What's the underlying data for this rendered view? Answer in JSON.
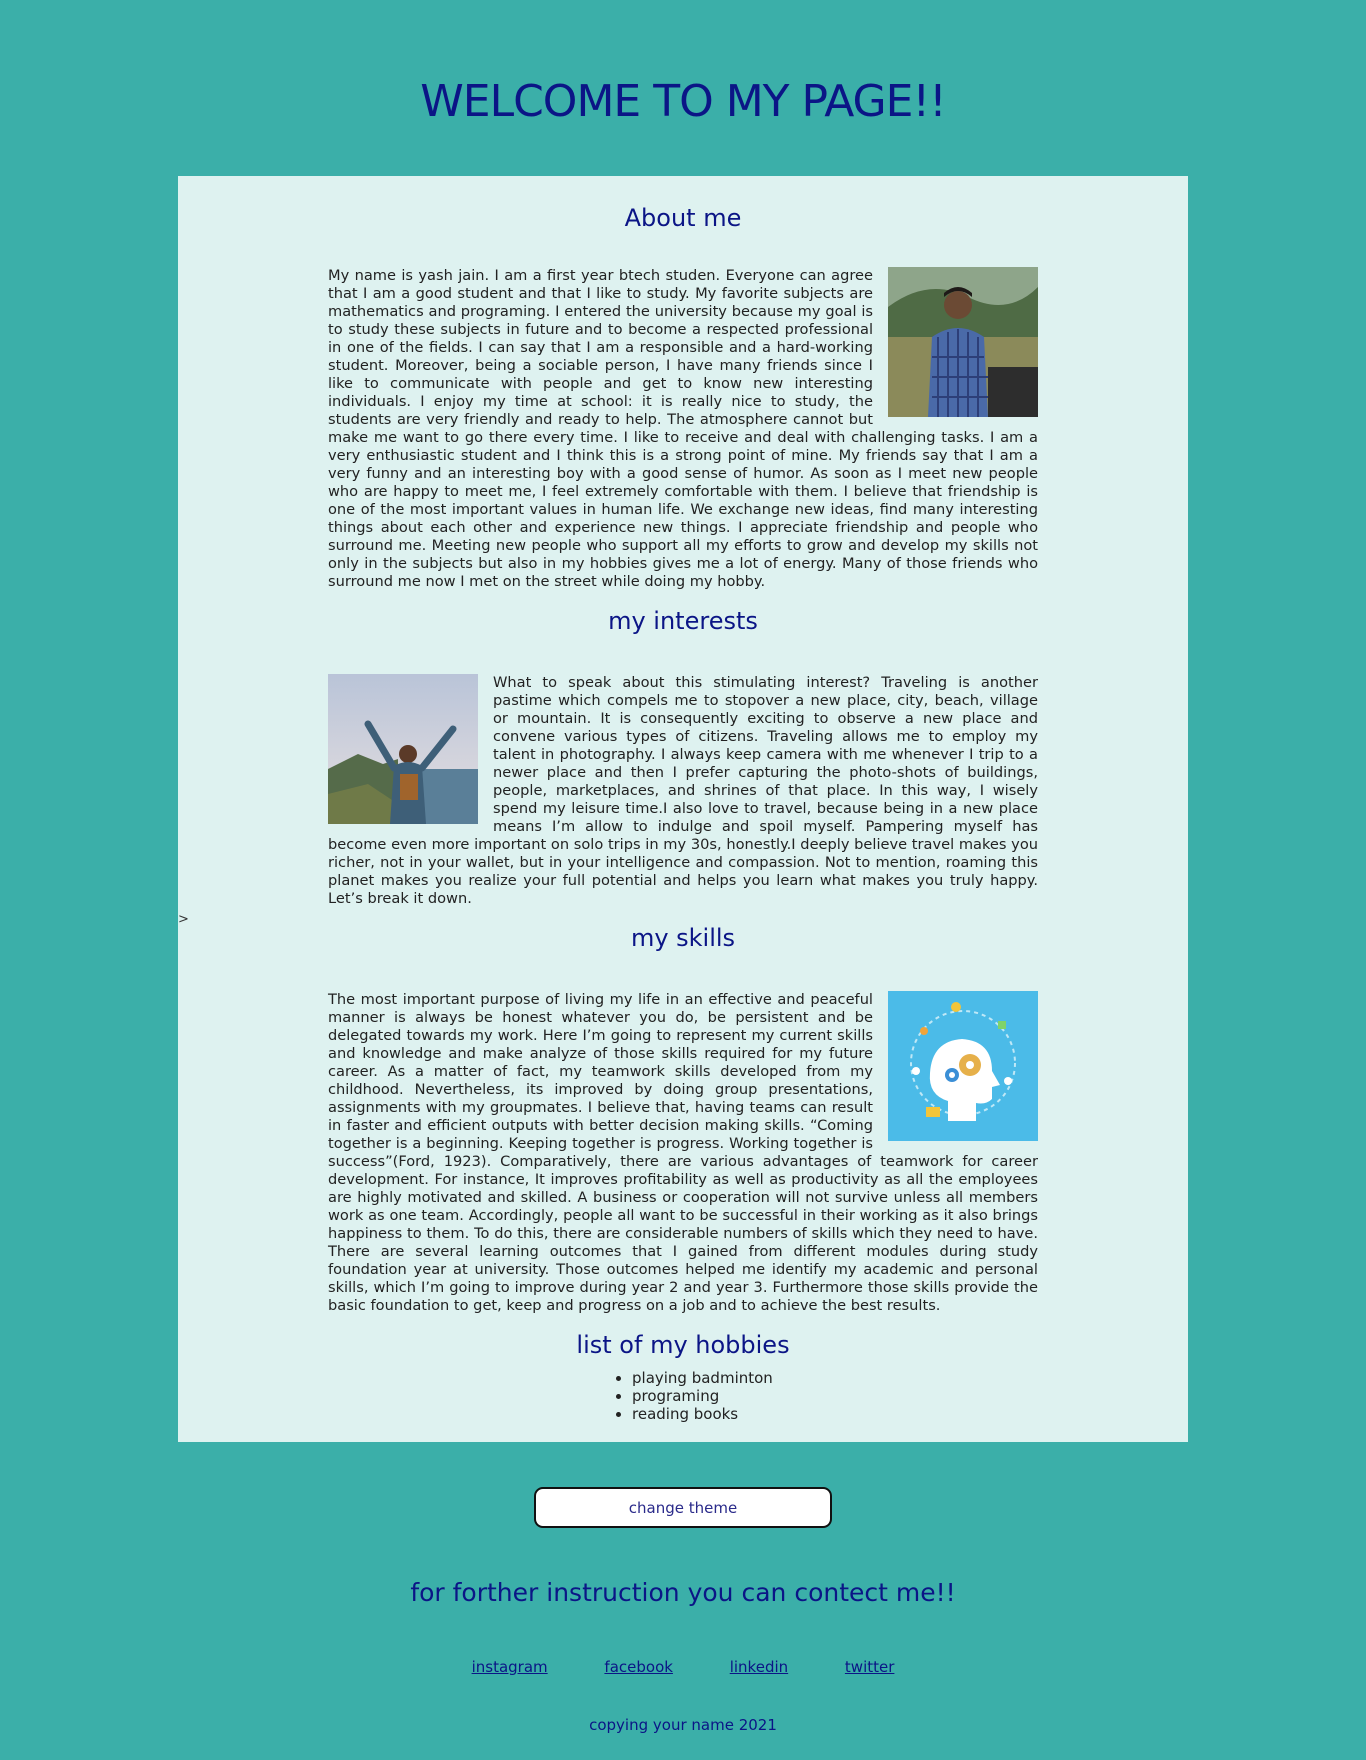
{
  "header": {
    "title": "WELCOME TO MY PAGE!!"
  },
  "stray_char": ">",
  "about": {
    "heading": "About me",
    "text": "My name is yash jain. I am a first year btech studen. Everyone can agree that I am a good student and that I like to study. My favorite subjects are mathematics and programing. I entered the university because my goal is to study these subjects in future and to become a respected professional in one of the fields. I can say that I am a responsible and a hard-working student. Moreover, being a sociable person, I have many friends since I like to communicate with people and get to know new interesting individuals. I enjoy my time at school: it is really nice to study, the students are very friendly and ready to help. The atmosphere cannot but make me want to go there every time. I like to receive and deal with challenging tasks. I am a very enthusiastic student and I think this is a strong point of mine. My friends say that I am a very funny and an interesting boy with a good sense of humor. As soon as I meet new people who are happy to meet me, I feel extremely comfortable with them. I believe that friendship is one of the most important values in human life. We exchange new ideas, find many interesting things about each other and experience new things. I appreciate friendship and people who surround me. Meeting new people who support all my efforts to grow and develop my skills not only in the subjects but also in my hobbies gives me a lot of energy. Many of those friends who surround me now I met on the street while doing my hobby."
  },
  "interests": {
    "heading": "my interests",
    "text": "What to speak about this stimulating interest? Traveling is another pastime which compels me to stopover a new place, city, beach, village or mountain. It is consequently exciting to observe a new place and convene various types of citizens. Traveling allows me to employ my talent in photography. I always keep camera with me whenever I trip to a newer place and then I prefer capturing the photo-shots of buildings, people, marketplaces, and shrines of that place. In this way, I wisely spend my leisure time.I also love to travel, because being in a new place means I’m allow to indulge and spoil myself. Pampering myself has become even more important on solo trips in my 30s, honestly.I deeply believe travel makes you richer, not in your wallet, but in your intelligence and compassion. Not to mention, roaming this planet makes you realize your full potential and helps you learn what makes you truly happy. Let’s break it down."
  },
  "skills": {
    "heading": "my skills",
    "text": "The most important purpose of living my life in an effective and peaceful manner is always be honest whatever you do, be persistent and be delegated towards my work. Here I’m going to represent my current skills and knowledge and make analyze of those skills required for my future career. As a matter of fact, my teamwork skills developed from my childhood. Nevertheless, its improved by doing group presentations, assignments with my groupmates. I believe that, having teams can result in faster and efficient outputs with better decision making skills. “Coming together is a beginning. Keeping together is progress. Working together is success”(Ford, 1923). Comparatively, there are various advantages of teamwork for career development. For instance, It improves profitability as well as productivity as all the employees are highly motivated and skilled. A business or cooperation will not survive unless all members work as one team. Accordingly, people all want to be successful in their working as it also brings happiness to them. To do this, there are considerable numbers of skills which they need to have. There are several learning outcomes that I gained from different modules during study foundation year at university. Those outcomes helped me identify my academic and personal skills, which I’m going to improve during year 2 and year 3. Furthermore those skills provide the basic foundation to get, keep and progress on a job and to achieve the best results."
  },
  "hobbies": {
    "heading": "list of my hobbies",
    "items": [
      "playing badminton",
      "programing",
      "reading books"
    ]
  },
  "theme_button": {
    "label": "change theme"
  },
  "contact": {
    "heading": "for forther instruction you can contect me!!",
    "links": [
      "instagram",
      "facebook",
      "linkedin",
      "twitter"
    ]
  },
  "footer": {
    "text": "copying your name 2021"
  },
  "colors": {
    "background": "#3bafa9",
    "card": "#def2f0",
    "heading": "#0b1586"
  }
}
